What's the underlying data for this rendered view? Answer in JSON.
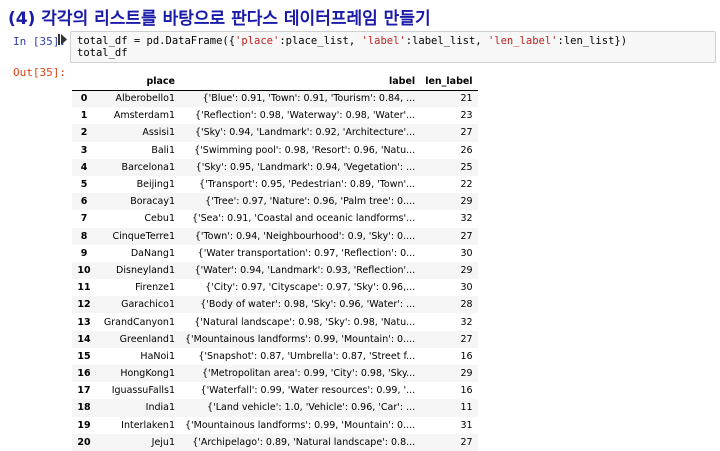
{
  "heading": "(4) 각각의 리스트를 바탕으로 판다스 데이터프레임 만들기",
  "cell_in": {
    "prompt": "In [35]:",
    "run_icon": "run-cell-icon",
    "code_line1_a": "total_df = pd.DataFrame({",
    "code_str_place": "'place'",
    "code_line1_b": ":place_list, ",
    "code_str_label": "'label'",
    "code_line1_c": ":label_list, ",
    "code_str_len": "'len_label'",
    "code_line1_d": ":len_list})",
    "code_line2": "total_df"
  },
  "cell_out": {
    "prompt": "Out[35]:"
  },
  "table": {
    "columns": [
      "place",
      "label",
      "len_label"
    ],
    "rows": [
      {
        "idx": "0",
        "place": "Alberobello1",
        "label": "{'Blue': 0.91, 'Town': 0.91, 'Tourism': 0.84, ...",
        "len": "21"
      },
      {
        "idx": "1",
        "place": "Amsterdam1",
        "label": "{'Reflection': 0.98, 'Waterway': 0.98, 'Water'...",
        "len": "23"
      },
      {
        "idx": "2",
        "place": "Assisi1",
        "label": "{'Sky': 0.94, 'Landmark': 0.92, 'Architecture'...",
        "len": "27"
      },
      {
        "idx": "3",
        "place": "Bali1",
        "label": "{'Swimming pool': 0.98, 'Resort': 0.96, 'Natu...",
        "len": "26"
      },
      {
        "idx": "4",
        "place": "Barcelona1",
        "label": "{'Sky': 0.95, 'Landmark': 0.94, 'Vegetation': ...",
        "len": "25"
      },
      {
        "idx": "5",
        "place": "Beijing1",
        "label": "{'Transport': 0.95, 'Pedestrian': 0.89, 'Town'...",
        "len": "22"
      },
      {
        "idx": "6",
        "place": "Boracay1",
        "label": "{'Tree': 0.97, 'Nature': 0.96, 'Palm tree': 0....",
        "len": "29"
      },
      {
        "idx": "7",
        "place": "Cebu1",
        "label": "{'Sea': 0.91, 'Coastal and oceanic landforms'...",
        "len": "32"
      },
      {
        "idx": "8",
        "place": "CinqueTerre1",
        "label": "{'Town': 0.94, 'Neighbourhood': 0.9, 'Sky': 0....",
        "len": "27"
      },
      {
        "idx": "9",
        "place": "DaNang1",
        "label": "{'Water transportation': 0.97, 'Reflection': 0...",
        "len": "30"
      },
      {
        "idx": "10",
        "place": "Disneyland1",
        "label": "{'Water': 0.94, 'Landmark': 0.93, 'Reflection'...",
        "len": "29"
      },
      {
        "idx": "11",
        "place": "Firenze1",
        "label": "{'City': 0.97, 'Cityscape': 0.97, 'Sky': 0.96,...",
        "len": "30"
      },
      {
        "idx": "12",
        "place": "Garachico1",
        "label": "{'Body of water': 0.98, 'Sky': 0.96, 'Water': ...",
        "len": "28"
      },
      {
        "idx": "13",
        "place": "GrandCanyon1",
        "label": "{'Natural landscape': 0.98, 'Sky': 0.98, 'Natu...",
        "len": "32"
      },
      {
        "idx": "14",
        "place": "Greenland1",
        "label": "{'Mountainous landforms': 0.99, 'Mountain': 0....",
        "len": "27"
      },
      {
        "idx": "15",
        "place": "HaNoi1",
        "label": "{'Snapshot': 0.87, 'Umbrella': 0.87, 'Street f...",
        "len": "16"
      },
      {
        "idx": "16",
        "place": "HongKong1",
        "label": "{'Metropolitan area': 0.99, 'City': 0.98, 'Sky...",
        "len": "29"
      },
      {
        "idx": "17",
        "place": "IguassuFalls1",
        "label": "{'Waterfall': 0.99, 'Water resources': 0.99, '...",
        "len": "16"
      },
      {
        "idx": "18",
        "place": "India1",
        "label": "{'Land vehicle': 1.0, 'Vehicle': 0.96, 'Car': ...",
        "len": "11"
      },
      {
        "idx": "19",
        "place": "Interlaken1",
        "label": "{'Mountainous landforms': 0.99, 'Mountain': 0....",
        "len": "31"
      },
      {
        "idx": "20",
        "place": "Jeju1",
        "label": "{'Archipelago': 0.89, 'Natural landscape': 0.8...",
        "len": "27"
      }
    ]
  }
}
